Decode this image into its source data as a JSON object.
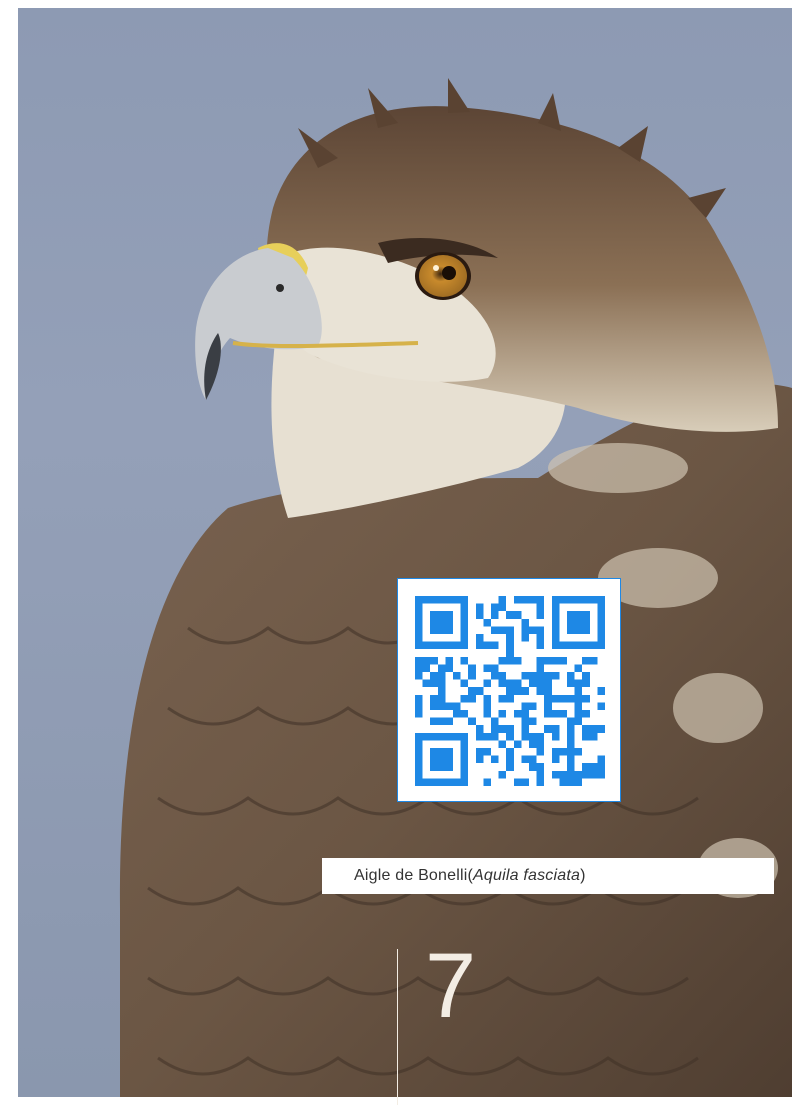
{
  "photo": {
    "subject": "eagle-head-photo"
  },
  "caption": {
    "common_name": "Aigle de Bonelli",
    "open_paren": " (",
    "scientific_name": "Aquila fasciata",
    "close_paren": ")"
  },
  "page_number": "7",
  "colors": {
    "sky": "#8f9bb4",
    "qr_blue": "#1e88e5",
    "feather_brown": "#6b5644",
    "caption_bg": "#ffffff"
  }
}
